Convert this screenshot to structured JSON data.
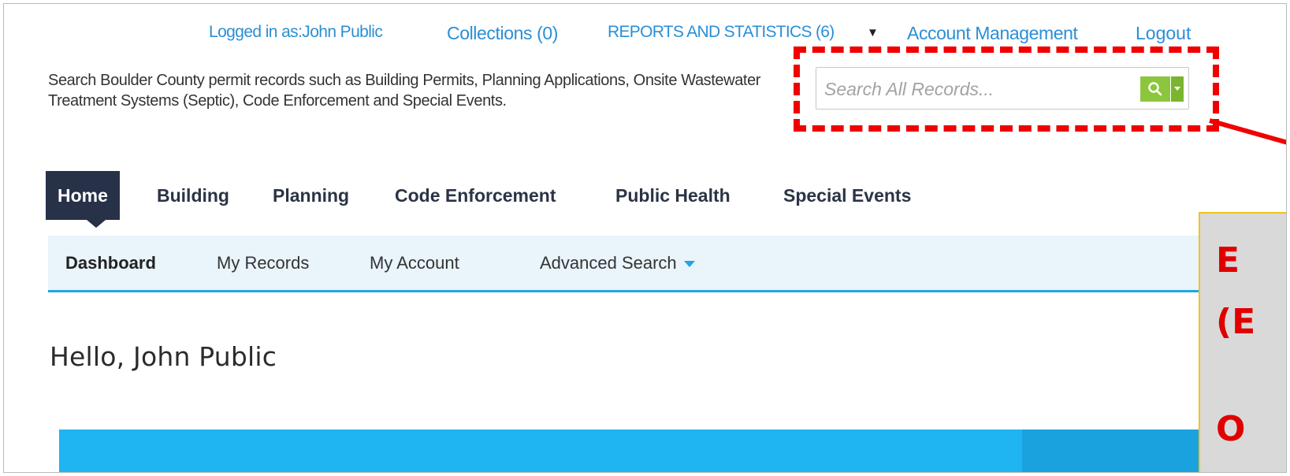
{
  "top_links": {
    "logged_in": "Logged in as:John Public",
    "collections": "Collections (0)",
    "reports": "REPORTS AND STATISTICS (6)",
    "account": "Account Management",
    "logout": "Logout"
  },
  "description": "Search Boulder County permit records such as Building Permits, Planning Applications, Onsite Wastewater Treatment Systems (Septic), Code Enforcement and Special Events.",
  "search": {
    "placeholder": "Search All Records..."
  },
  "main_nav": [
    "Home",
    "Building",
    "Planning",
    "Code Enforcement",
    "Public Health",
    "Special Events"
  ],
  "sub_nav": [
    "Dashboard",
    "My Records",
    "My Account",
    "Advanced Search"
  ],
  "greeting": "Hello, John Public",
  "callout": {
    "line1": "E",
    "line2": "(E",
    "line3": "O"
  },
  "colors": {
    "link": "#2a8fd6",
    "nav_active": "#273148",
    "search_button": "#8cc63f",
    "highlight": "#f00000",
    "subnav_bg": "#e9f4fb",
    "accent_bar": "#1fb4f2"
  },
  "icons": [
    "caret-down-icon",
    "search-icon",
    "dropdown-caret-icon"
  ]
}
